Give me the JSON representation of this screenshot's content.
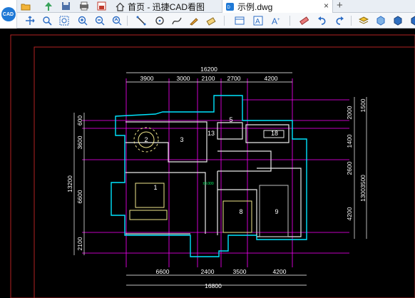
{
  "app": {
    "logo_text": "CAD"
  },
  "tabs": [
    {
      "label": "首页 - 迅捷CAD看图",
      "icon": "home-icon"
    },
    {
      "label": "示例.dwg",
      "icon": "dwg-file-icon"
    }
  ],
  "quick_access": [
    "open-folder-icon",
    "pin-icon",
    "save-icon",
    "print-icon",
    "recent-file-icon"
  ],
  "toolbar": [
    "move-zoom-icon",
    "zoom-window-icon",
    "zoom-extents-icon",
    "zoom-in-icon",
    "zoom-out-icon",
    "zoom-previous-icon",
    "line-icon",
    "circle-icon",
    "polyline-icon",
    "sketch-icon",
    "eraser-measure-icon",
    "layout-icon",
    "text-box-icon",
    "text-style-icon",
    "eraser-icon",
    "undo-icon",
    "redo-icon",
    "layer-icon",
    "3d-box-icon",
    "3d-view-icon",
    "cube-icon"
  ],
  "drawing": {
    "dims_top": {
      "total": "16200",
      "segments": [
        "3900",
        "3000",
        "2100",
        "2700",
        "4200"
      ]
    },
    "dims_bottom": {
      "total": "16800",
      "segments": [
        "6600",
        "2400",
        "3500",
        "4200"
      ]
    },
    "dims_left": {
      "total": "13200",
      "segments": [
        "600",
        "3600",
        "6600",
        "2100"
      ]
    },
    "dims_right": {
      "total": "13003500",
      "segments": [
        "1500",
        "2000",
        "1400",
        "2600",
        "4200"
      ]
    },
    "rooms": [
      "1",
      "2",
      "3",
      "13",
      "5",
      "18",
      "8",
      "9"
    ],
    "small_label": "±0.000",
    "colors": {
      "wall": "#e8e8e8",
      "outline": "#00e5ff",
      "axis": "#ff00ff",
      "dim": "#ffffff",
      "furniture": "#f0e68c",
      "frame": "#b22222"
    }
  },
  "colors": {
    "accent": "#1f79d6",
    "close": "#d9534f"
  }
}
